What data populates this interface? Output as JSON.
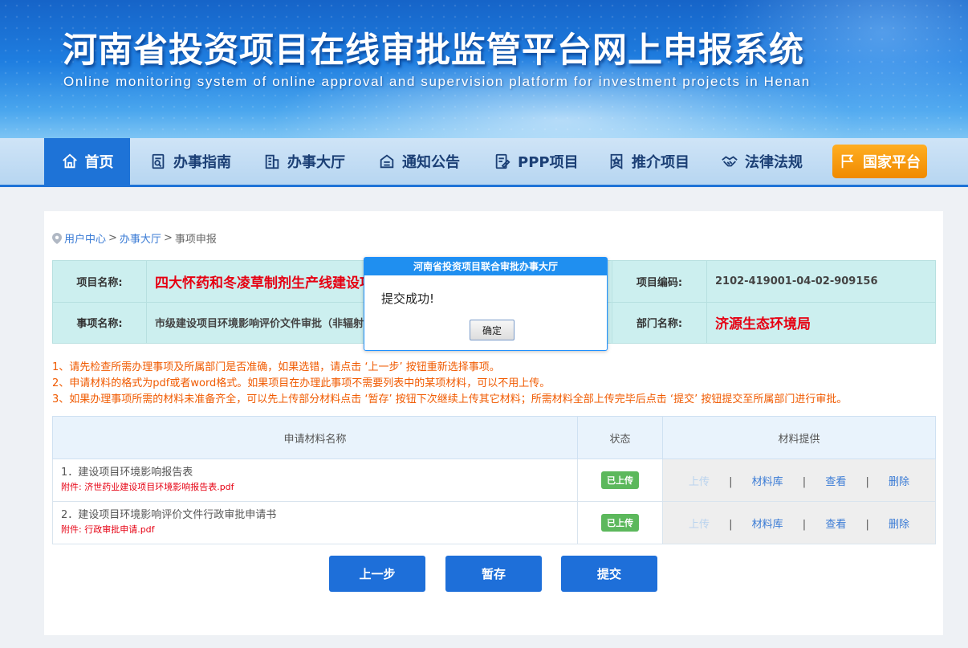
{
  "header": {
    "title": "河南省投资项目在线审批监管平台网上申报系统",
    "subtitle": "Online monitoring system of online approval and supervision platform for investment projects in Henan"
  },
  "nav": {
    "items": [
      {
        "label": "首页",
        "icon": "home-icon"
      },
      {
        "label": "办事指南",
        "icon": "guide-icon"
      },
      {
        "label": "办事大厅",
        "icon": "building-icon"
      },
      {
        "label": "通知公告",
        "icon": "notice-icon"
      },
      {
        "label": "PPP项目",
        "icon": "edit-icon"
      },
      {
        "label": "推介项目",
        "icon": "star-badge-icon"
      },
      {
        "label": "法律法规",
        "icon": "handshake-icon"
      },
      {
        "label": "国家平台",
        "icon": "flag-icon"
      }
    ]
  },
  "breadcrumb": {
    "item1": "用户中心",
    "sep1": ">",
    "item2": "办事大厅",
    "sep2": ">",
    "item3": "事项申报"
  },
  "project": {
    "name_label": "项目名称:",
    "name_value": "四大怀药和冬凌草制剂生产线建设项目",
    "code_label": "项目编码:",
    "code_value": "2102-419001-04-02-909156",
    "item_label": "事项名称:",
    "item_value": "市级建设项目环境影响评价文件审批（非辐射类）",
    "dept_label": "部门名称:",
    "dept_value": "济源生态环境局"
  },
  "notes": [
    "1、请先检查所需办理事项及所属部门是否准确，如果选错，请点击 ‘上一步’ 按钮重新选择事项。",
    "2、申请材料的格式为pdf或者word格式。如果项目在办理此事项不需要列表中的某项材料，可以不用上传。",
    "3、如果办理事项所需的材料未准备齐全，可以先上传部分材料点击 ‘暂存’ 按钮下次继续上传其它材料；所需材料全部上传完毕后点击 ‘提交’ 按钮提交至所属部门进行审批。"
  ],
  "materials": {
    "headers": {
      "name": "申请材料名称",
      "status": "状态",
      "provide": "材料提供"
    },
    "rows": [
      {
        "name": "1．建设项目环境影响报告表",
        "attachment": "附件: 济世药业建设项目环境影响报告表.pdf",
        "status": "已上传"
      },
      {
        "name": "2．建设项目环境影响评价文件行政审批申请书",
        "attachment": "附件: 行政审批申请.pdf",
        "status": "已上传"
      }
    ],
    "ops": {
      "upload": "上传",
      "library": "材料库",
      "view": "查看",
      "delete": "删除",
      "sep": "|"
    }
  },
  "buttons": {
    "prev": "上一步",
    "save": "暂存",
    "submit": "提交"
  },
  "dialog": {
    "title": "河南省投资项目联合审批办事大厅",
    "message": "提交成功!",
    "ok": "确定"
  },
  "colors": {
    "primary": "#1e6fd9",
    "accent": "#f08a00",
    "error": "#e60012",
    "success": "#5cb85c"
  }
}
